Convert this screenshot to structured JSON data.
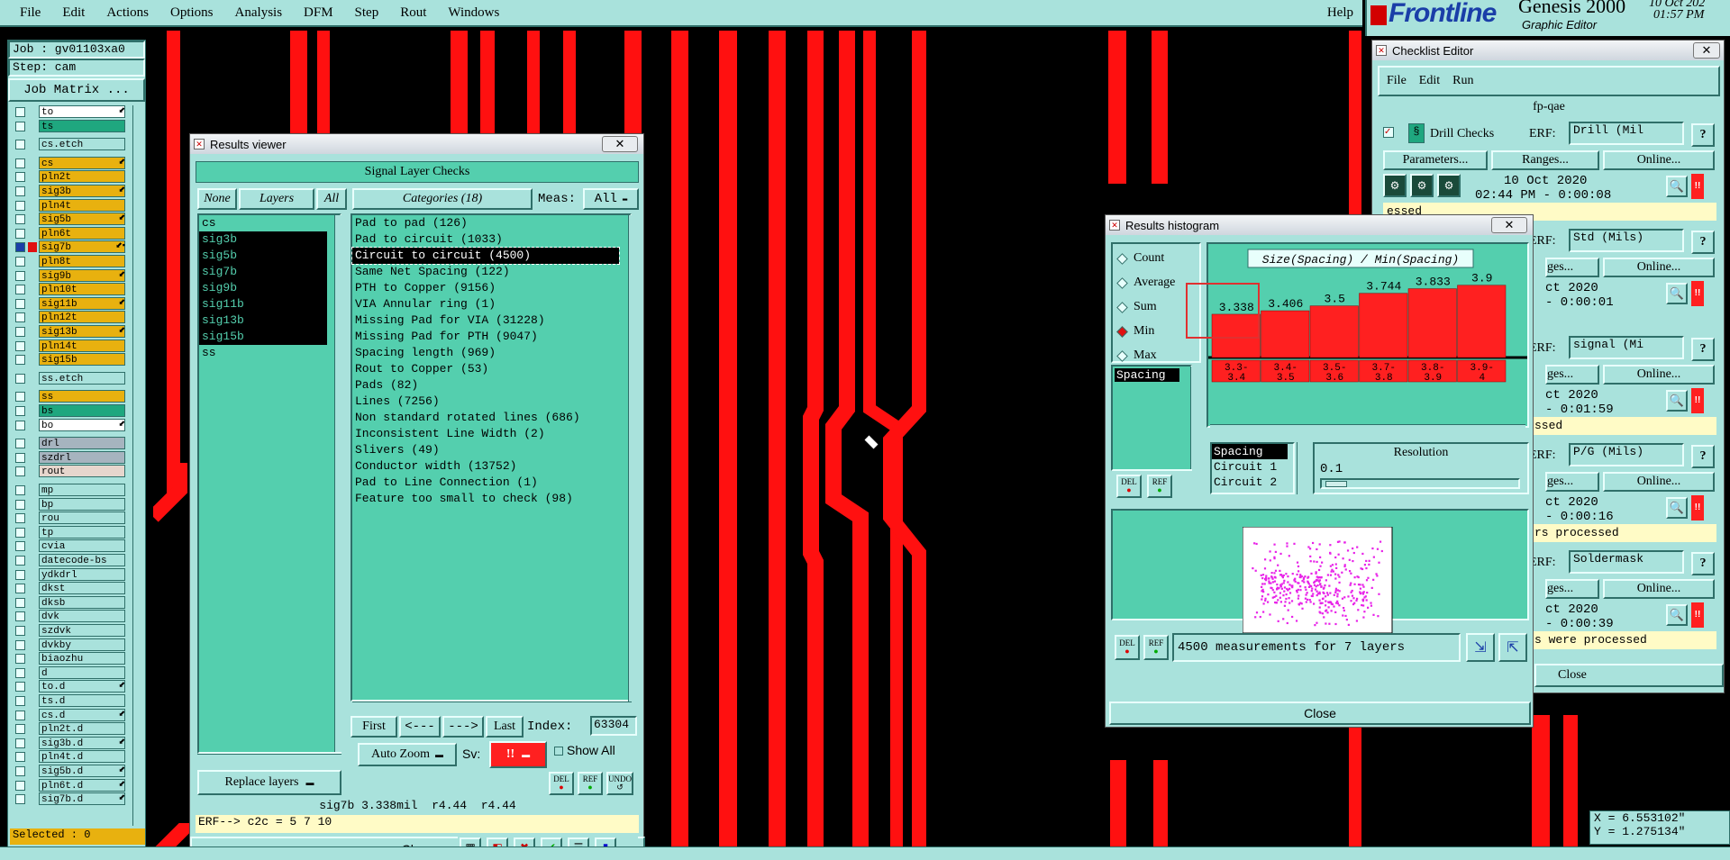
{
  "menubar": {
    "items": [
      "File",
      "Edit",
      "Actions",
      "Options",
      "Analysis",
      "DFM",
      "Step",
      "Rout",
      "Windows"
    ],
    "help": "Help"
  },
  "brand": {
    "logo": "Frontline",
    "product": "Genesis 2000",
    "subtitle": "Graphic Editor",
    "date": "10 Oct 202",
    "time": "01:57 PM"
  },
  "job_panel": {
    "job": "Job : gv01103xa0",
    "step": "Step: cam",
    "job_matrix": "Job Matrix ...",
    "layers": [
      {
        "name": "to",
        "c": "#ffffff",
        "mark": "⬋"
      },
      {
        "name": "ts",
        "c": "#1fa77f"
      },
      {
        "sep": true
      },
      {
        "name": "cs.etch",
        "c": "#a9e2dc"
      },
      {
        "sep": true
      },
      {
        "name": "cs",
        "c": "#e8b10f",
        "mark": "⬋"
      },
      {
        "name": "pln2t",
        "c": "#e8b10f"
      },
      {
        "name": "sig3b",
        "c": "#e8b10f",
        "mark": "⬋"
      },
      {
        "name": "pln4t",
        "c": "#e8b10f"
      },
      {
        "name": "sig5b",
        "c": "#e8b10f",
        "mark": "⬋"
      },
      {
        "name": "pln6t",
        "c": "#e8b10f"
      },
      {
        "name": "sig7b",
        "c": "#e8b10f",
        "mark": "⬋▪",
        "active": true
      },
      {
        "name": "pln8t",
        "c": "#e8b10f"
      },
      {
        "name": "sig9b",
        "c": "#e8b10f",
        "mark": "⬋"
      },
      {
        "name": "pln10t",
        "c": "#e8b10f"
      },
      {
        "name": "sig11b",
        "c": "#e8b10f",
        "mark": "⬋"
      },
      {
        "name": "pln12t",
        "c": "#e8b10f"
      },
      {
        "name": "sig13b",
        "c": "#e8b10f",
        "mark": "⬋"
      },
      {
        "name": "pln14t",
        "c": "#e8b10f"
      },
      {
        "name": "sig15b",
        "c": "#e8b10f"
      },
      {
        "sep": true
      },
      {
        "name": "ss.etch",
        "c": "#a9e2dc"
      },
      {
        "sep": true
      },
      {
        "name": "ss",
        "c": "#e8b10f"
      },
      {
        "name": "bs",
        "c": "#1fa77f"
      },
      {
        "name": "bo",
        "c": "#ffffff",
        "mark": "⬋"
      },
      {
        "sep": true
      },
      {
        "name": "drl",
        "c": "#a6b4bf"
      },
      {
        "name": "szdrl",
        "c": "#a6b4bf"
      },
      {
        "name": "rout",
        "c": "#e6d6cd"
      },
      {
        "sep": true
      },
      {
        "name": "mp",
        "c": "#a9e2dc"
      },
      {
        "name": "bp",
        "c": "#a9e2dc"
      },
      {
        "name": "rou",
        "c": "#a9e2dc"
      },
      {
        "name": "tp",
        "c": "#a9e2dc"
      },
      {
        "name": "cvia",
        "c": "#a9e2dc"
      },
      {
        "name": "datecode-bs",
        "c": "#a9e2dc"
      },
      {
        "name": "ydkdrl",
        "c": "#a9e2dc"
      },
      {
        "name": "dkst",
        "c": "#a9e2dc"
      },
      {
        "name": "dksb",
        "c": "#a9e2dc"
      },
      {
        "name": "dvk",
        "c": "#a9e2dc"
      },
      {
        "name": "szdvk",
        "c": "#a9e2dc"
      },
      {
        "name": "dvkby",
        "c": "#a9e2dc"
      },
      {
        "name": "biaozhu",
        "c": "#a9e2dc"
      },
      {
        "name": "d",
        "c": "#a9e2dc"
      },
      {
        "name": "to.d",
        "c": "#a9e2dc",
        "mark": "⬋"
      },
      {
        "name": "ts.d",
        "c": "#a9e2dc"
      },
      {
        "name": "cs.d",
        "c": "#a9e2dc",
        "mark": "⬋"
      },
      {
        "name": "pln2t.d",
        "c": "#a9e2dc"
      },
      {
        "name": "sig3b.d",
        "c": "#a9e2dc",
        "mark": "⬋"
      },
      {
        "name": "pln4t.d",
        "c": "#a9e2dc"
      },
      {
        "name": "sig5b.d",
        "c": "#a9e2dc",
        "mark": "⬋"
      },
      {
        "name": "pln6t.d",
        "c": "#a9e2dc",
        "mark": "⬋"
      },
      {
        "name": "sig7b.d",
        "c": "#a9e2dc",
        "mark": "⬋"
      }
    ],
    "selected": "Selected : 0"
  },
  "results_viewer": {
    "window_title": "Results viewer",
    "header": "Signal Layer Checks",
    "none": "None",
    "layers_label": "Layers",
    "all": "All",
    "categories_label": "Categories (18)",
    "meas_label": "Meas:",
    "meas_value": "All",
    "layer_list": [
      {
        "name": "cs",
        "sel": false
      },
      {
        "name": "sig3b",
        "sel": true
      },
      {
        "name": "sig5b",
        "sel": true
      },
      {
        "name": "sig7b",
        "sel": true
      },
      {
        "name": "sig9b",
        "sel": true
      },
      {
        "name": "sig11b",
        "sel": true
      },
      {
        "name": "sig13b",
        "sel": true
      },
      {
        "name": "sig15b",
        "sel": true
      },
      {
        "name": "ss",
        "sel": false
      }
    ],
    "categories": [
      "Pad to pad (126)",
      "Pad to circuit (1033)",
      "Circuit to circuit (4500)",
      "Same Net Spacing (122)",
      "PTH to Copper (9156)",
      "VIA Annular ring (1)",
      "Missing Pad for VIA (31228)",
      "Missing Pad for PTH (9047)",
      "Spacing length (969)",
      "Rout to Copper (53)",
      "Pads (82)",
      "Lines (7256)",
      "Non standard rotated lines (686)",
      "Inconsistent Line Width (2)",
      "Slivers (49)",
      "Conductor width (13752)",
      "Pad to Line Connection (1)",
      "Feature too small to check (98)"
    ],
    "selected_category": 2,
    "first": "First",
    "prev": "<---",
    "next": "--->",
    "last": "Last",
    "index_label": "Index:",
    "index_value": "63304",
    "auto_zoom": "Auto Zoom",
    "sv_label": "Sv:",
    "sv_value": "!!",
    "show_all": "Show All",
    "replace_layers": "Replace layers",
    "del": "DEL",
    "ref": "REF",
    "undo": "UNDO",
    "status": "sig7b 3.338mil  r4.44  r4.44",
    "erf": "ERF--> c2c = 5 7 10",
    "close": "Close"
  },
  "histogram": {
    "window_title": "Results histogram",
    "modes": [
      "Count",
      "Average",
      "Sum",
      "Min",
      "Max"
    ],
    "selected_mode": "Min",
    "title": "Size(Spacing) / Min(Spacing)",
    "measure_list": [
      "Spacing"
    ],
    "del": "DEL",
    "ref": "REF",
    "options": [
      "Spacing",
      "Circuit 1",
      "Circuit 2"
    ],
    "resolution_label": "Resolution",
    "resolution_value": "0.1",
    "summary": "4500 measurements for 7 layers",
    "close": "Close"
  },
  "chart_data": {
    "type": "bar",
    "title": "Size(Spacing) / Min(Spacing)",
    "categories": [
      "3.3-3.4",
      "3.4-3.5",
      "3.5-3.6",
      "3.7-3.8",
      "3.8-3.9",
      "3.9-4"
    ],
    "category_lines": [
      [
        "3.3-",
        "3.4"
      ],
      [
        "3.4-",
        "3.5"
      ],
      [
        "3.5-",
        "3.6"
      ],
      [
        "3.7-",
        "3.8"
      ],
      [
        "3.8-",
        "3.9"
      ],
      [
        "3.9-",
        "4"
      ]
    ],
    "values": [
      3.338,
      3.406,
      3.5,
      3.744,
      3.833,
      3.9
    ],
    "value_labels": [
      "3.338",
      "3.406",
      "3.5",
      "3.744",
      "3.833",
      "3.9"
    ],
    "ylim": [
      2.5,
      4.0
    ],
    "bar_color": "#ff2020"
  },
  "checklist": {
    "window_title": "Checklist Editor",
    "menu": [
      "File",
      "Edit",
      "Run"
    ],
    "name": "fp-qae",
    "first_check": "Drill Checks",
    "erf_label": "ERF:",
    "erfs": [
      "Drill (Mil",
      "Std (Mils)",
      "signal (Mi",
      "P/G (Mils)",
      "Soldermask"
    ],
    "parameters": "Parameters...",
    "ranges": "Ranges...",
    "ranges_short": "ges...",
    "online": "Online...",
    "date_first": "10 Oct 2020",
    "date_short": "ct 2020",
    "times": [
      "02:44 PM - 0:00:08",
      "- 0:00:01",
      "- 0:01:59",
      "- 0:00:16",
      "- 0:00:39"
    ],
    "statuses": [
      "essed",
      "",
      "ssed",
      "rs processed",
      "s were processed"
    ],
    "close": "Close",
    "help": "?",
    "alert": "!!"
  },
  "coords": {
    "x": "X = 6.553102\"",
    "y": "Y = 1.275134\""
  }
}
